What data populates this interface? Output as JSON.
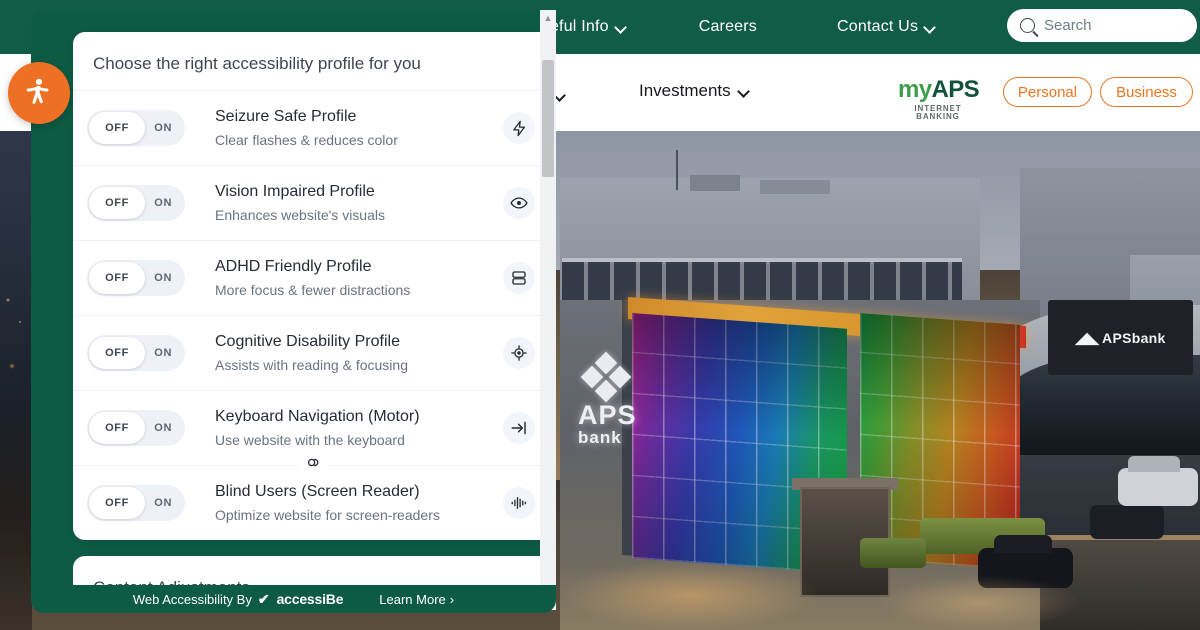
{
  "topnav": {
    "links": [
      {
        "label": "Useful Info",
        "has_chevron": true
      },
      {
        "label": "Careers",
        "has_chevron": false
      },
      {
        "label": "Contact Us",
        "has_chevron": true
      }
    ],
    "search": {
      "placeholder": "Search",
      "icon": "search-icon"
    },
    "background_color": "#105c46"
  },
  "subnav": {
    "investments_label": "Investments",
    "logo": {
      "my": "my",
      "aps": "APS",
      "tagline": "INTERNET BANKING"
    },
    "personal_label": "Personal",
    "business_label": "Business",
    "accent_color": "#ef7521"
  },
  "accessibility_panel": {
    "title": "Choose the right accessibility profile for you",
    "panel_color": "#0d5b45",
    "launcher_color": "#ee7024",
    "launcher_icon": "accessibility-person-icon",
    "toggle": {
      "off_label": "OFF",
      "on_label": "ON",
      "state": "off"
    },
    "profiles": [
      {
        "name": "Seizure Safe Profile",
        "desc": "Clear flashes & reduces color",
        "icon": "lightning-bolt-icon"
      },
      {
        "name": "Vision Impaired Profile",
        "desc": "Enhances website's visuals",
        "icon": "eye-icon"
      },
      {
        "name": "ADHD Friendly Profile",
        "desc": "More focus & fewer distractions",
        "icon": "focus-panel-icon"
      },
      {
        "name": "Cognitive Disability Profile",
        "desc": "Assists with reading & focusing",
        "icon": "crosshair-target-icon"
      },
      {
        "name": "Keyboard Navigation (Motor)",
        "desc": "Use website with the keyboard",
        "icon": "arrow-to-right-icon"
      },
      {
        "name": "Blind Users (Screen Reader)",
        "desc": "Optimize website for screen-readers",
        "icon": "audio-waveform-icon"
      }
    ],
    "link_divider_icon": "linked-chain-icon",
    "content_adjustments_label": "Content Adjustments",
    "scrollbar": {
      "up_arrow": "▲",
      "down_arrow": "▼"
    }
  },
  "accessibe_bar": {
    "prefix": "Web Accessibility By",
    "brand": "accessiBe",
    "check_icon": "checkmark-icon",
    "learn_more": "Learn More",
    "chevron": "›"
  },
  "hero": {
    "building_sign": "APSbank",
    "wall_logo_line1": "APS",
    "wall_logo_line2": "bank"
  }
}
